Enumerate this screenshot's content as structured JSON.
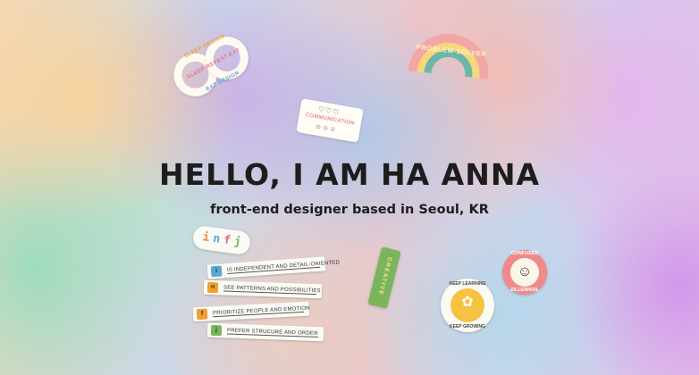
{
  "hero": {
    "title": "HELLO, I AM HA ANNA",
    "subtitle": "front-end designer based in Seoul, KR"
  },
  "stickers": {
    "infinity": {
      "top": "SLEEP DESIGN",
      "middle": "SLEEP REPEAT EAT",
      "bottom": "EAT DESIGN"
    },
    "rainbow": {
      "text": "PROBLEM-SOLVER"
    },
    "communication": {
      "hearts": "♡♡♡",
      "word": "COMMUNICATION",
      "faces": "☺☺☺"
    },
    "infj": {
      "letters": [
        "i",
        "n",
        "f",
        "j"
      ],
      "colors": [
        "#e98a3a",
        "#5aa6d6",
        "#e86b8a",
        "#7ab55c"
      ]
    },
    "creative": {
      "text": "CREATIVE"
    },
    "keep": {
      "top": "KEEP LEARNING",
      "bottom": "KEEP GROWING",
      "flower": "✿"
    },
    "confused": {
      "top": "CONFUSED",
      "bottom": "ZILLENNIAL",
      "face": "☺"
    }
  },
  "mbti": [
    {
      "letter": "i",
      "desc": "IS INDEPENDENT AND DETAIL-ORIENTED",
      "color": "#5aa6d6"
    },
    {
      "letter": "n",
      "desc": "SEE PATTERNS AND POSSIBILITIES",
      "color": "#f0a030"
    },
    {
      "letter": "f",
      "desc": "PRIORITIZE PEOPLE AND EMOTION",
      "color": "#f0a030"
    },
    {
      "letter": "j",
      "desc": "PREFER STRUCURE AND ORDER",
      "color": "#7ab55c"
    }
  ]
}
